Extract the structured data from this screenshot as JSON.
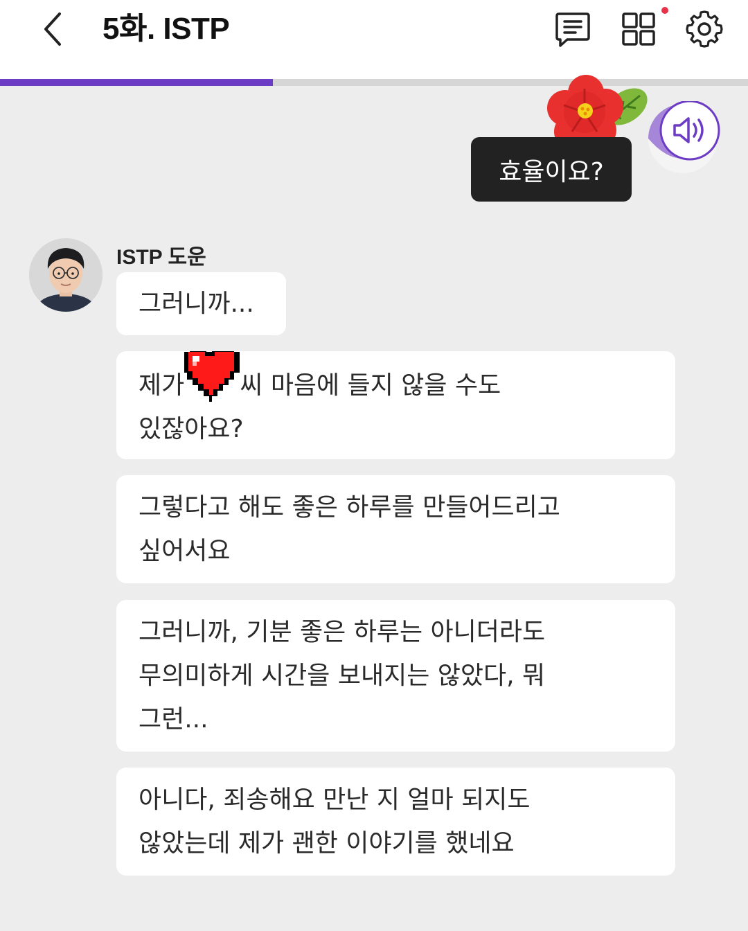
{
  "header": {
    "title": "5화. ISTP",
    "has_notification": true
  },
  "progress": {
    "fraction": 0.365,
    "color": "#6c3cc4",
    "track_color": "#d6d6d6"
  },
  "colors": {
    "accent": "#6c3cc4",
    "notification_dot": "#e8334a",
    "my_bubble_bg": "#222222",
    "bubble_bg": "#ffffff",
    "page_bg": "#ededed"
  },
  "icons": {
    "back": "chevron-left-icon",
    "script": "chat-transcript-icon",
    "episodes": "grid-icon",
    "settings": "gear-icon",
    "sound": "speaker-icon",
    "flower": "flower-sticker",
    "heart": "pixel-heart-icon"
  },
  "my_message": {
    "text": "효율이요?"
  },
  "sender": {
    "name": "ISTP 도운"
  },
  "messages": [
    {
      "lines": [
        "그러니까..."
      ]
    },
    {
      "before_heart": "제가",
      "after_heart": "씨 마음에 들지 않을 수도",
      "line2": "있잖아요?"
    },
    {
      "lines": [
        "그렇다고 해도 좋은 하루를 만들어드리고",
        "싶어서요"
      ]
    },
    {
      "lines": [
        "그러니까, 기분 좋은 하루는 아니더라도",
        "무의미하게 시간을 보내지는 않았다, 뭐",
        "그런..."
      ]
    },
    {
      "lines": [
        "아니다, 죄송해요 만난 지 얼마 되지도",
        "않았는데 제가 괜한 이야기를 했네요"
      ]
    }
  ]
}
